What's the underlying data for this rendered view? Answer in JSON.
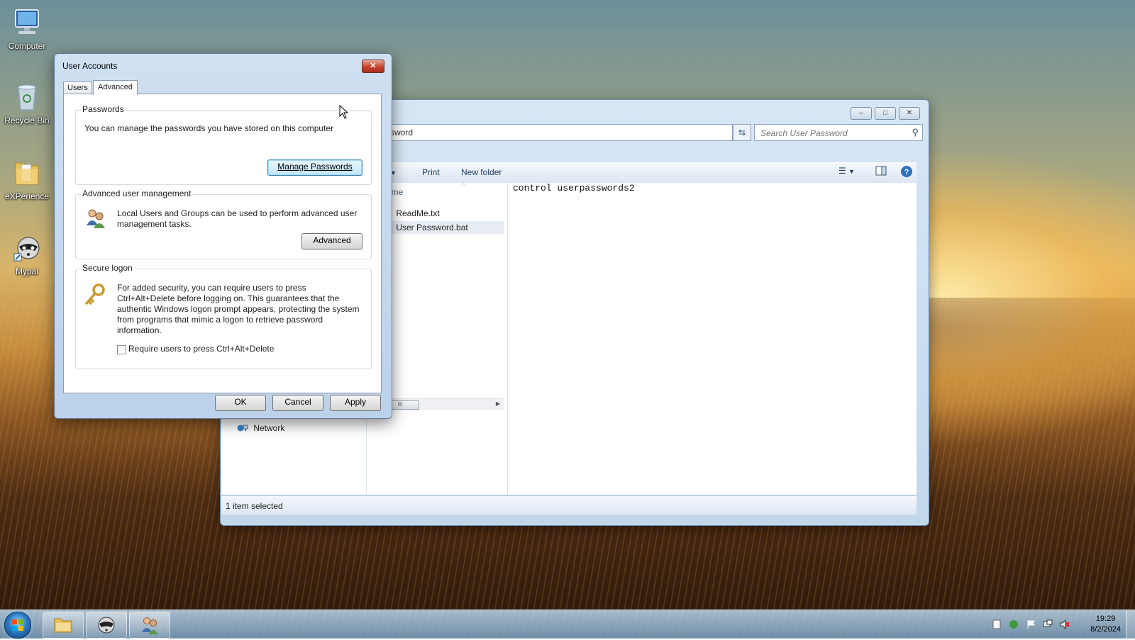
{
  "desktop": {
    "icons": [
      {
        "label": "Computer"
      },
      {
        "label": "Recycle Bin"
      },
      {
        "label": "eXPerience"
      },
      {
        "label": "Mypal"
      }
    ]
  },
  "explorer": {
    "address_tail": "ssword",
    "search_placeholder": "Search User Password",
    "toolbar": {
      "partial": "h",
      "print": "Print",
      "new_folder": "New folder"
    },
    "column_partial": "ame",
    "files": [
      "ReadMe.txt",
      "User Password.bat"
    ],
    "nav_network": "Network",
    "preview_text": "control userpasswords2",
    "status": "1 item selected",
    "scroll_thumb": "III"
  },
  "dialog": {
    "title": "User Accounts",
    "tabs": [
      "Users",
      "Advanced"
    ],
    "active_tab": "Advanced",
    "passwords": {
      "legend": "Passwords",
      "text": "You can manage the passwords you have stored on this computer",
      "button": "Manage Passwords"
    },
    "advanced_mgmt": {
      "legend": "Advanced user management",
      "text": "Local Users and Groups can be used to perform advanced user management tasks.",
      "button": "Advanced"
    },
    "secure_logon": {
      "legend": "Secure logon",
      "text": "For added security, you can require users to press Ctrl+Alt+Delete before logging on. This guarantees that the authentic Windows logon prompt appears, protecting the system from programs that mimic a logon to retrieve password information.",
      "checkbox_label": "Require users to press Ctrl+Alt+Delete",
      "checked": false
    },
    "buttons": {
      "ok": "OK",
      "cancel": "Cancel",
      "apply": "Apply"
    }
  },
  "taskbar": {
    "time": "19:29",
    "date": "8/2/2024"
  }
}
